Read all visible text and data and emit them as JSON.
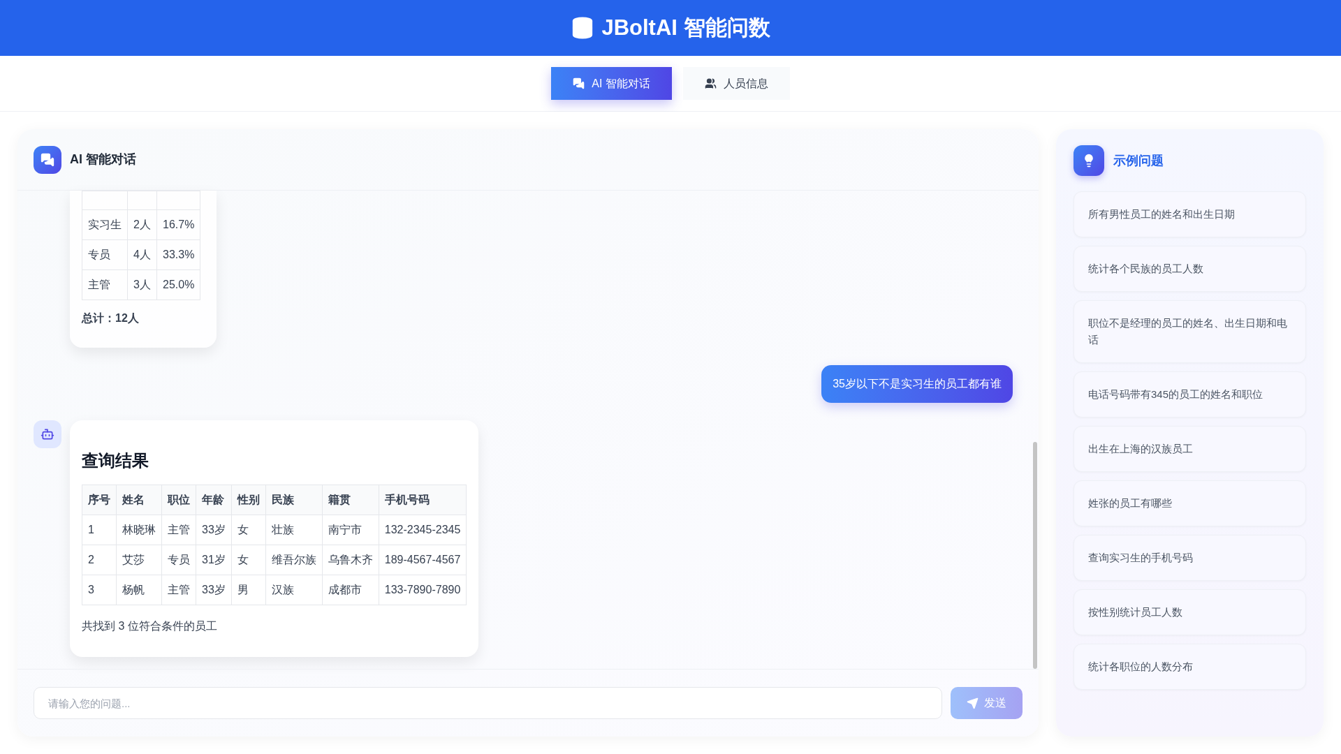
{
  "header": {
    "title": "JBoltAI 智能问数"
  },
  "tabs": [
    {
      "label": "AI 智能对话",
      "selected": true,
      "kind": "chat"
    },
    {
      "label": "人员信息",
      "selected": false,
      "kind": "people"
    }
  ],
  "chat": {
    "title": "AI 智能对话",
    "messages": [
      {
        "kind": "stats",
        "rows": [
          [
            "实习生",
            "2人",
            "16.7%"
          ],
          [
            "专员",
            "4人",
            "33.3%"
          ],
          [
            "主管",
            "3人",
            "25.0%"
          ]
        ],
        "total": "总计：12人"
      },
      {
        "kind": "user",
        "text": "35岁以下不是实习生的员工都有谁"
      },
      {
        "kind": "result",
        "title": "查询结果",
        "columns": [
          "序号",
          "姓名",
          "职位",
          "年龄",
          "性别",
          "民族",
          "籍贯",
          "手机号码"
        ],
        "rows": [
          [
            "1",
            "林晓琳",
            "主管",
            "33岁",
            "女",
            "壮族",
            "南宁市",
            "132-2345-2345"
          ],
          [
            "2",
            "艾莎",
            "专员",
            "31岁",
            "女",
            "维吾尔族",
            "乌鲁木齐",
            "189-4567-4567"
          ],
          [
            "3",
            "杨帆",
            "主管",
            "33岁",
            "男",
            "汉族",
            "成都市",
            "133-7890-7890"
          ]
        ],
        "summary": "共找到 3 位符合条件的员工"
      }
    ],
    "input": {
      "placeholder": "请输入您的问题..."
    },
    "send_button": {
      "label": "发送",
      "disabled": true
    }
  },
  "sidebar": {
    "title": "示例问题",
    "items": [
      "所有男性员工的姓名和出生日期",
      "统计各个民族的员工人数",
      "职位不是经理的员工的姓名、出生日期和电话",
      "电话号码带有345的员工的姓名和职位",
      "出生在上海的汉族员工",
      "姓张的员工有哪些",
      "查询实习生的手机号码",
      "按性别统计员工人数",
      "统计各职位的人数分布"
    ]
  }
}
